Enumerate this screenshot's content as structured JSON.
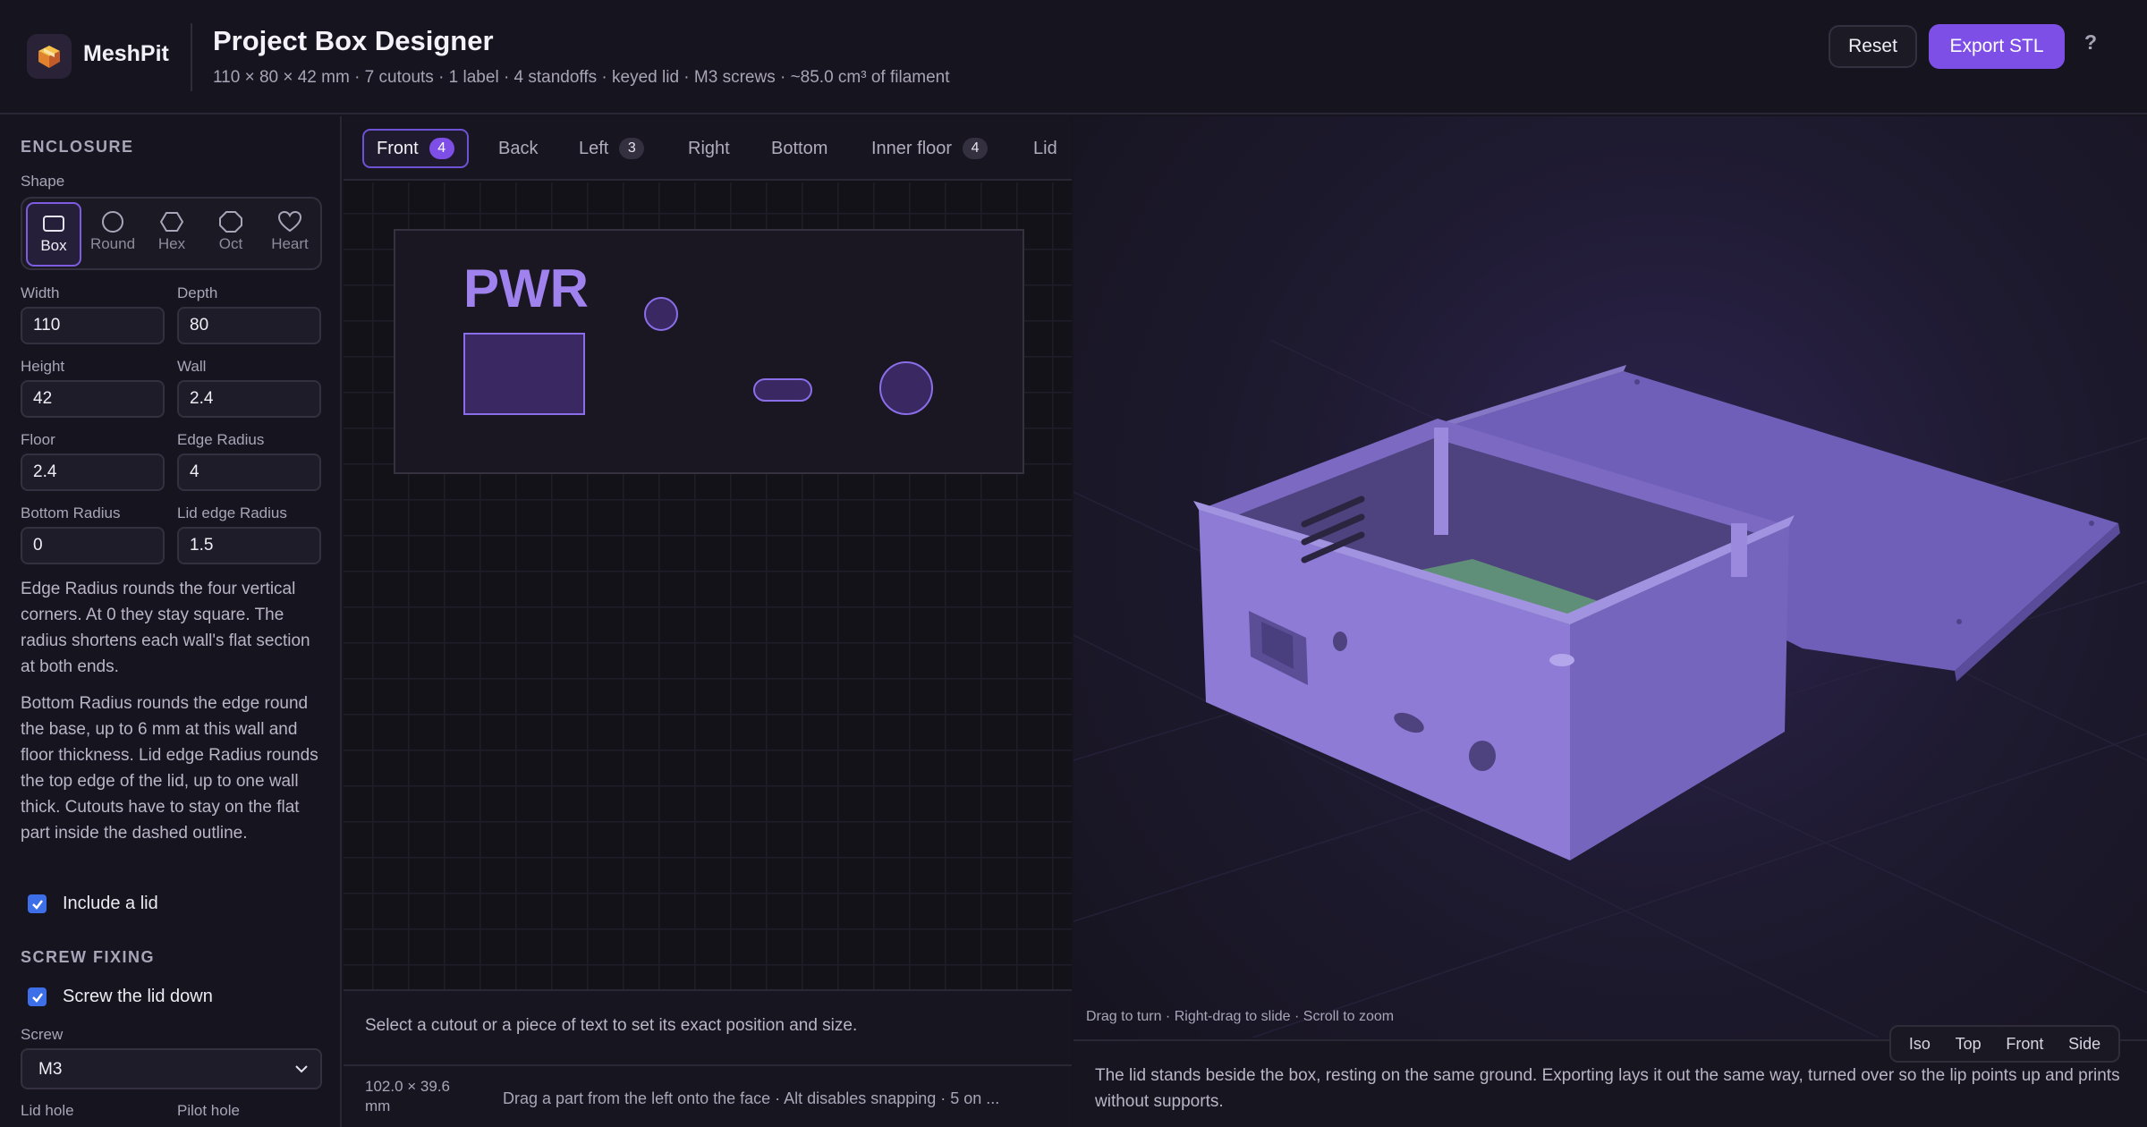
{
  "app": {
    "name": "MeshPit",
    "title": "Project Box Designer",
    "summary": "110 × 80 × 42 mm · 7 cutouts · 1 label · 4 standoffs · keyed lid · M3 screws · ~85.0 cm³ of filament"
  },
  "header": {
    "reset_label": "Reset",
    "export_label": "Export STL",
    "help_label": "?"
  },
  "colors": {
    "accent": "#7d4fe6",
    "model": "#8a78d0",
    "pcb": "#5f8f78"
  },
  "sidebar": {
    "enclosure_title": "ENCLOSURE",
    "shape_label": "Shape",
    "shapes": [
      {
        "label": "Box",
        "icon": "square-icon"
      },
      {
        "label": "Round",
        "icon": "circle-icon"
      },
      {
        "label": "Hex",
        "icon": "hexagon-icon"
      },
      {
        "label": "Oct",
        "icon": "octagon-icon"
      },
      {
        "label": "Heart",
        "icon": "heart-icon"
      }
    ],
    "selected_shape": "Box",
    "fields": [
      {
        "label": "Width",
        "value": "110"
      },
      {
        "label": "Depth",
        "value": "80"
      },
      {
        "label": "Height",
        "value": "42"
      },
      {
        "label": "Wall",
        "value": "2.4"
      },
      {
        "label": "Floor",
        "value": "2.4"
      },
      {
        "label": "Edge Radius",
        "value": "4"
      },
      {
        "label": "Bottom Radius",
        "value": "0"
      },
      {
        "label": "Lid edge Radius",
        "value": "1.5"
      }
    ],
    "help_edge": "Edge Radius rounds the four vertical corners. At 0 they stay square. The radius shortens each wall's flat section at both ends.",
    "help_bottom": "Bottom Radius rounds the edge round the base, up to 6 mm at this wall and floor thickness. Lid edge Radius rounds the top edge of the lid, up to one wall thick. Cutouts have to stay on the flat part inside the dashed outline.",
    "include_lid_label": "Include a lid",
    "include_lid": true,
    "screw_title": "SCREW FIXING",
    "screw_lid_label": "Screw the lid down",
    "screw_lid": true,
    "screw_label": "Screw",
    "screw_value": "M3",
    "lid_hole_label": "Lid hole",
    "pilot_hole_label": "Pilot hole"
  },
  "faces": {
    "tabs": [
      {
        "label": "Front",
        "count": "4",
        "active": true
      },
      {
        "label": "Back",
        "count": ""
      },
      {
        "label": "Left",
        "count": "3"
      },
      {
        "label": "Right",
        "count": ""
      },
      {
        "label": "Bottom",
        "count": ""
      },
      {
        "label": "Inner floor",
        "count": "4"
      },
      {
        "label": "Lid",
        "count": ""
      }
    ],
    "label_text": "PWR",
    "select_hint": "Select a cutout or a piece of text to set its exact position and size.",
    "face_dims": "102.0 × 39.6 mm",
    "drag_hint": "Drag a part from the left onto the face · Alt disables snapping · 5 on ..."
  },
  "viewport": {
    "orbit_hint": "Drag to turn · Right-drag to slide · Scroll to zoom",
    "view_buttons": [
      "Iso",
      "Top",
      "Front",
      "Side"
    ],
    "note": "The lid stands beside the box, resting on the same ground. Exporting lays it out the same way, turned over so the lip points up and prints without supports."
  }
}
